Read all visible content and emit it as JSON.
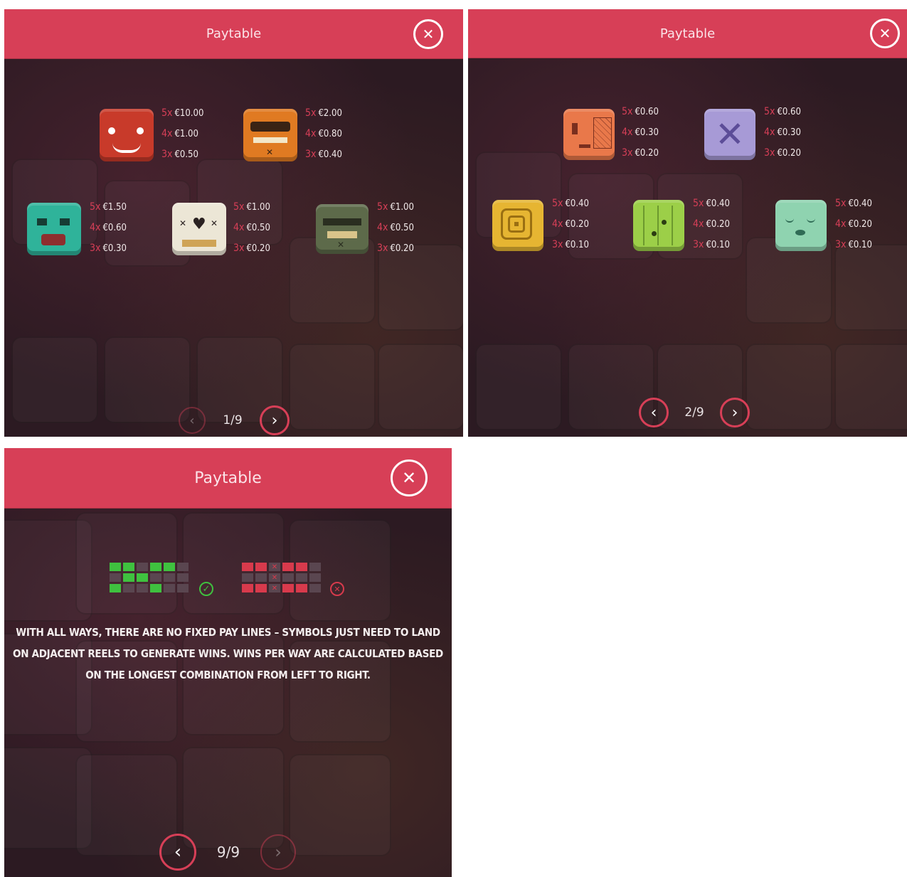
{
  "panels": [
    {
      "title": "Paytable",
      "page": "1/9",
      "symbols": [
        {
          "name": "red-mask",
          "color": "#c83a2a",
          "pays": [
            {
              "mult": "5x",
              "amount": "€10.00"
            },
            {
              "mult": "4x",
              "amount": "€1.00"
            },
            {
              "mult": "3x",
              "amount": "€0.50"
            }
          ]
        },
        {
          "name": "orange-mask",
          "color": "#e07a22",
          "pays": [
            {
              "mult": "5x",
              "amount": "€2.00"
            },
            {
              "mult": "4x",
              "amount": "€0.80"
            },
            {
              "mult": "3x",
              "amount": "€0.40"
            }
          ]
        },
        {
          "name": "teal-mask",
          "color": "#2fb39a",
          "pays": [
            {
              "mult": "5x",
              "amount": "€1.50"
            },
            {
              "mult": "4x",
              "amount": "€0.60"
            },
            {
              "mult": "3x",
              "amount": "€0.30"
            }
          ]
        },
        {
          "name": "skull-mask",
          "color": "#ece6d6",
          "pays": [
            {
              "mult": "5x",
              "amount": "€1.00"
            },
            {
              "mult": "4x",
              "amount": "€0.50"
            },
            {
              "mult": "3x",
              "amount": "€0.20"
            }
          ]
        },
        {
          "name": "green-mask",
          "color": "#5d6a4a",
          "pays": [
            {
              "mult": "5x",
              "amount": "€1.00"
            },
            {
              "mult": "4x",
              "amount": "€0.50"
            },
            {
              "mult": "3x",
              "amount": "€0.20"
            }
          ]
        }
      ]
    },
    {
      "title": "Paytable",
      "page": "2/9",
      "symbols": [
        {
          "name": "orange-patch-block",
          "color": "#e9784a",
          "pays": [
            {
              "mult": "5x",
              "amount": "€0.60"
            },
            {
              "mult": "4x",
              "amount": "€0.30"
            },
            {
              "mult": "3x",
              "amount": "€0.20"
            }
          ]
        },
        {
          "name": "purple-x-block",
          "color": "#a79ad6",
          "pays": [
            {
              "mult": "5x",
              "amount": "€0.60"
            },
            {
              "mult": "4x",
              "amount": "€0.30"
            },
            {
              "mult": "3x",
              "amount": "€0.20"
            }
          ]
        },
        {
          "name": "yellow-spiral-block",
          "color": "#e6b532",
          "pays": [
            {
              "mult": "5x",
              "amount": "€0.40"
            },
            {
              "mult": "4x",
              "amount": "€0.20"
            },
            {
              "mult": "3x",
              "amount": "€0.10"
            }
          ]
        },
        {
          "name": "green-dots-block",
          "color": "#9ccf48",
          "pays": [
            {
              "mult": "5x",
              "amount": "€0.40"
            },
            {
              "mult": "4x",
              "amount": "€0.20"
            },
            {
              "mult": "3x",
              "amount": "€0.10"
            }
          ]
        },
        {
          "name": "mint-face-block",
          "color": "#8fd3b0",
          "pays": [
            {
              "mult": "5x",
              "amount": "€0.40"
            },
            {
              "mult": "4x",
              "amount": "€0.20"
            },
            {
              "mult": "3x",
              "amount": "€0.10"
            }
          ]
        }
      ]
    },
    {
      "title": "Paytable",
      "page": "9/9",
      "info_lines": [
        "WITH ALL WAYS, THERE ARE NO FIXED PAY LINES – SYMBOLS JUST NEED TO LAND",
        "ON ADJACENT REELS TO GENERATE WINS. WINS PER WAY ARE CALCULATED BASED",
        "ON THE LONGEST COMBINATION FROM LEFT TO RIGHT."
      ],
      "valid_grid": [
        [
          1,
          1,
          0,
          1,
          1,
          0
        ],
        [
          0,
          1,
          1,
          0,
          0,
          0
        ],
        [
          1,
          0,
          0,
          1,
          0,
          0
        ]
      ],
      "invalid_grid": [
        [
          1,
          1,
          2,
          1,
          1,
          0
        ],
        [
          0,
          0,
          2,
          0,
          0,
          0
        ],
        [
          1,
          1,
          2,
          1,
          1,
          0
        ]
      ],
      "colors": {
        "valid": "#3fc13f",
        "invalid": "#d83a4c",
        "empty": "#5a4650"
      }
    }
  ],
  "colors": {
    "header": "#d73f57",
    "accent": "#d73f57",
    "background": "#2c1a22"
  },
  "icons": {
    "close": "close-icon",
    "prev": "chevron-left-icon",
    "next": "chevron-right-icon",
    "valid": "check-circle-icon",
    "invalid": "x-circle-icon"
  }
}
